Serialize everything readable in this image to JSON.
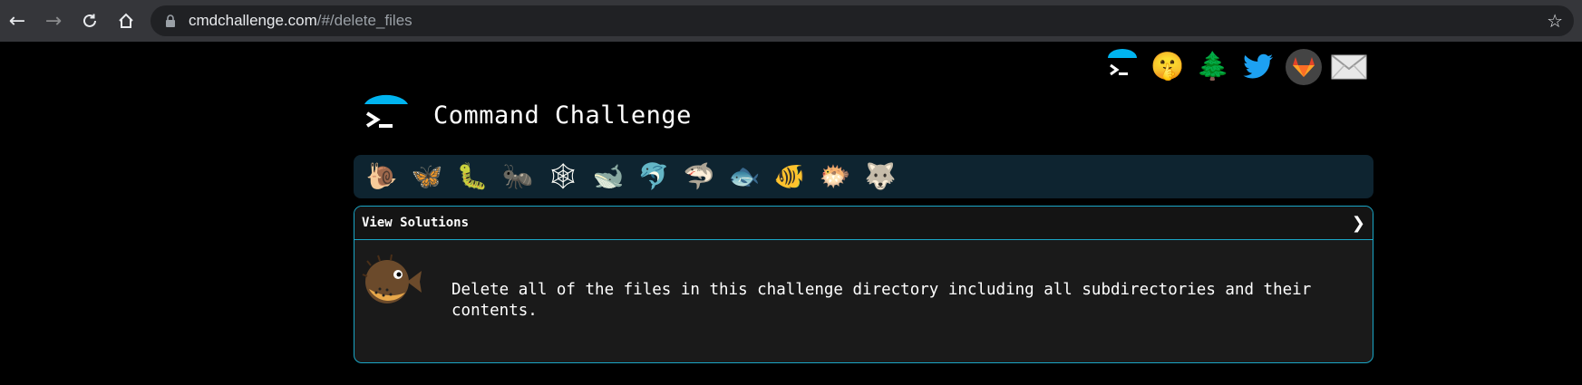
{
  "browser": {
    "url_host": "cmdchallenge.com",
    "url_path": "/#/delete_files"
  },
  "header_links": [
    {
      "name": "cmdchallenge-logo-link",
      "glyph": ""
    },
    {
      "name": "shh-emoji-link",
      "glyph": "🤫"
    },
    {
      "name": "tree-link",
      "glyph": "🌲"
    },
    {
      "name": "twitter-link",
      "glyph": "🐦"
    },
    {
      "name": "gitlab-link",
      "glyph": ""
    },
    {
      "name": "email-link",
      "glyph": "✉"
    }
  ],
  "brand": {
    "title": "Command Challenge"
  },
  "levels": [
    {
      "name": "level-snail-icon",
      "glyph": "🐌"
    },
    {
      "name": "level-butterfly-icon",
      "glyph": "🦋"
    },
    {
      "name": "level-caterpillar-icon",
      "glyph": "🐛"
    },
    {
      "name": "level-ant-icon",
      "glyph": "🐜"
    },
    {
      "name": "level-spider-web-icon",
      "glyph": "🕸"
    },
    {
      "name": "level-whale-icon",
      "glyph": "🐋"
    },
    {
      "name": "level-dolphin-icon",
      "glyph": "🐬"
    },
    {
      "name": "level-shark-icon",
      "glyph": "🦈"
    },
    {
      "name": "level-fish-icon",
      "glyph": "🐟"
    },
    {
      "name": "level-tropical-fish-icon",
      "glyph": "🐠"
    },
    {
      "name": "level-blowfish-icon",
      "glyph": "🐡"
    },
    {
      "name": "level-wolf-icon",
      "glyph": "🐺"
    }
  ],
  "panel": {
    "header_label": "View Solutions",
    "chevron": "❯",
    "description": "Delete all of the files in this challenge directory including all subdirectories and their contents."
  },
  "colors": {
    "accent": "#1aa6c6",
    "logo_blue": "#00b4f0",
    "level_bar_bg": "#0e2430",
    "panel_bg": "#1a1a1a"
  }
}
